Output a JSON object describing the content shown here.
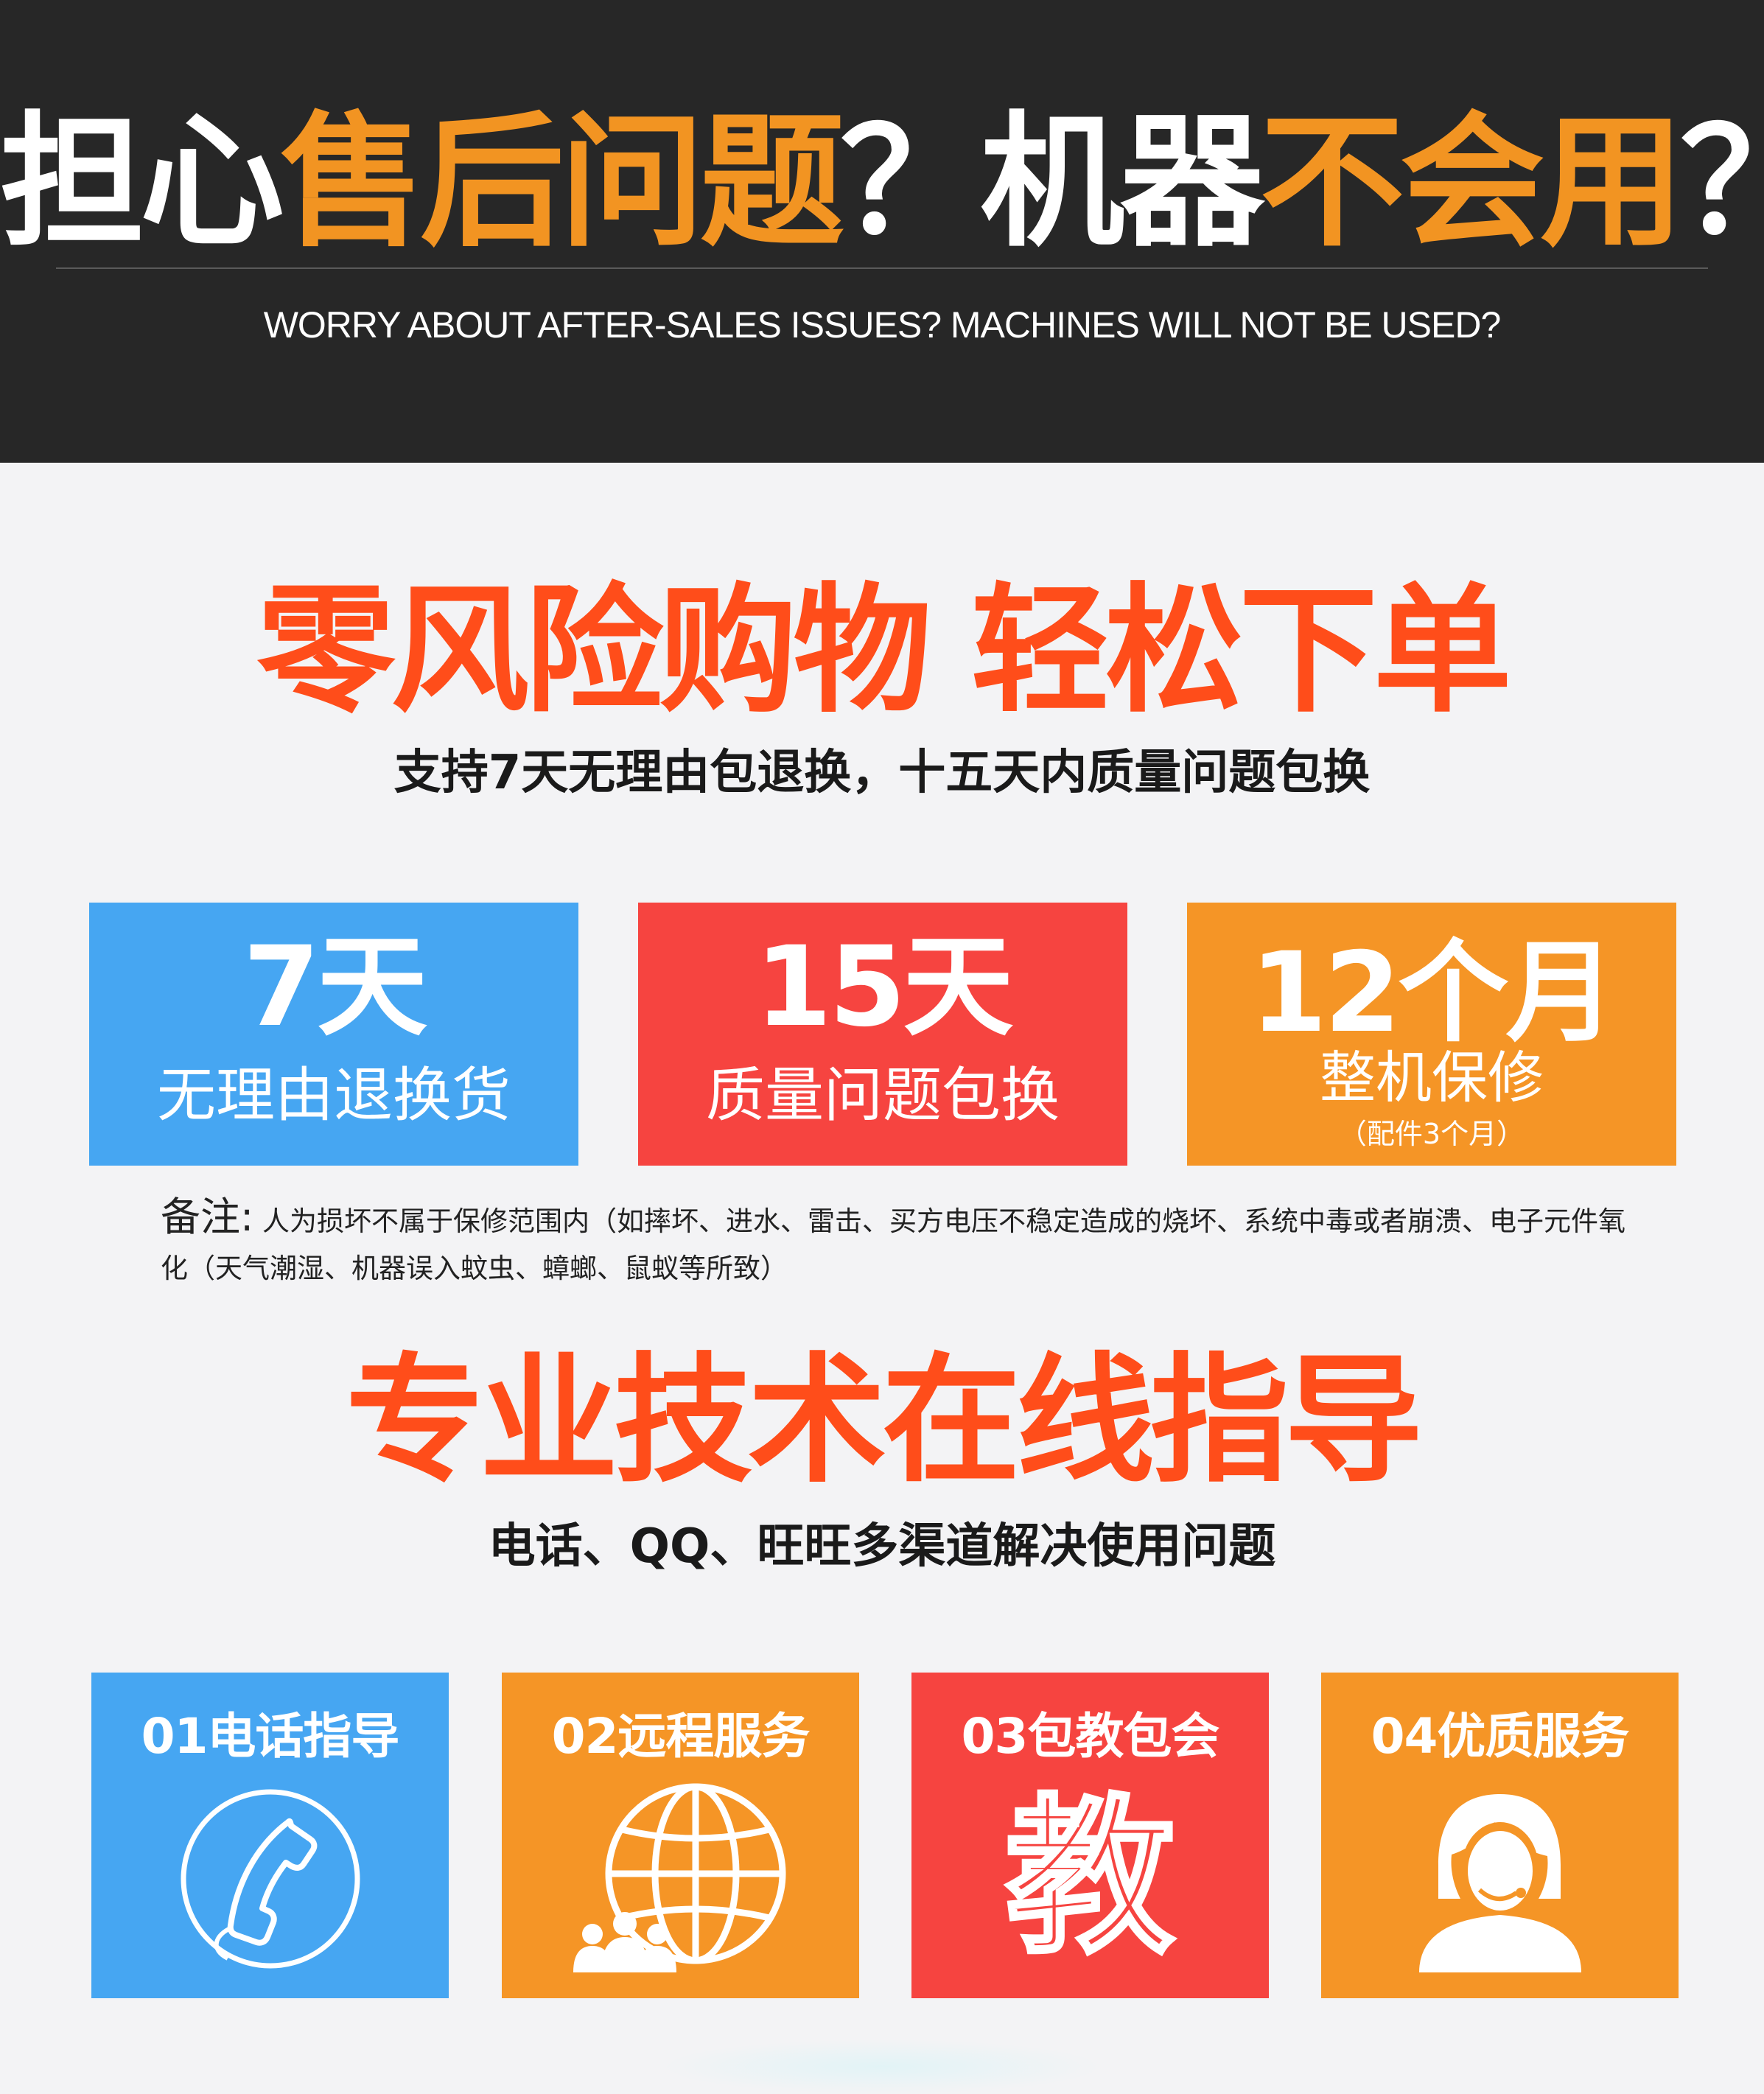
{
  "hero": {
    "title_part1": "担心",
    "title_part2": "售后问题",
    "title_part3": "？机器",
    "title_part4": "不会用",
    "title_part5": "？",
    "subtitle": "WORRY ABOUT AFTER-SALES ISSUES? MACHINES WILL NOT BE USED?",
    "accent_color": "#f29422"
  },
  "section1": {
    "title": "零风险购物 轻松下单",
    "subtitle": "支持7天无理由包退换，十五天内质量问题包换",
    "title_color": "#ff4d1a"
  },
  "guarantees": [
    {
      "big": "7天",
      "label": "无理由退换货",
      "color": "#46a6f2"
    },
    {
      "big": "15天",
      "label": "质量问题包换",
      "color": "#f64440"
    },
    {
      "big": "12个月",
      "label": "整机保修",
      "note": "（配件3个月）",
      "color": "#f59526"
    }
  ],
  "note": {
    "label": "备注:",
    "text": "人为损坏不属于保修范围内（如摔坏、进水、雷击、买方电压不稳定造成的烧坏、系统中毒或者崩溃、电子元件氧化（天气潮湿、机器误入蚊虫、蟑螂、鼠蚁等所致）"
  },
  "section2": {
    "title": "专业技术在线指导",
    "subtitle": "电话、QQ、旺旺多渠道解决使用问题"
  },
  "services": [
    {
      "label": "01电话指导",
      "icon": "phone-icon",
      "color": "#46a6f2"
    },
    {
      "label": "02远程服务",
      "icon": "globe-people-icon",
      "color": "#f59526"
    },
    {
      "label": "03包教包会",
      "icon": "teach-character-icon",
      "glyph": "教",
      "color": "#f64440"
    },
    {
      "label": "04优质服务",
      "icon": "headset-agent-icon",
      "color": "#f59526"
    }
  ]
}
